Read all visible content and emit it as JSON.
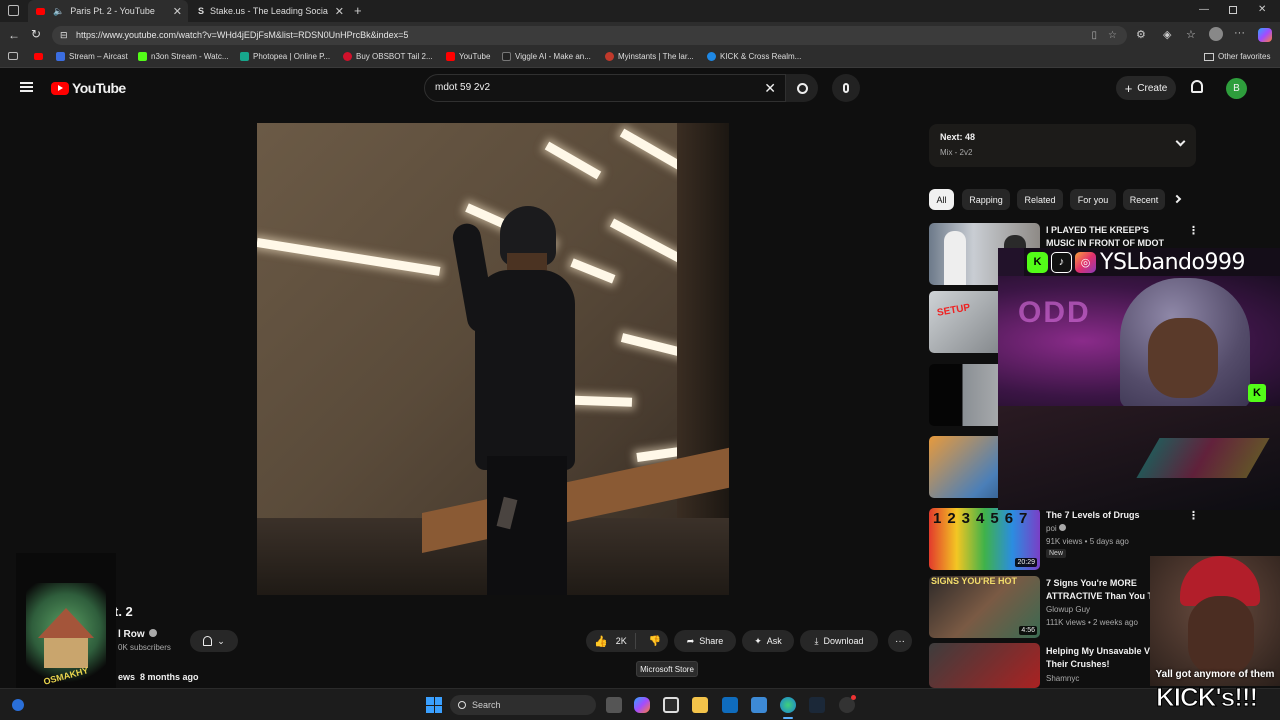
{
  "browser": {
    "tabs": [
      {
        "title": "Paris Pt. 2 - YouTube",
        "active": true
      },
      {
        "title": "Stake.us - The Leading Social Cas",
        "active": false
      }
    ],
    "url": "https://www.youtube.com/watch?v=WHd4jEDjFsM&list=RDSN0UnHPrcBk&index=5",
    "bookmarks": [
      {
        "label": "Stream – Aircast",
        "color": "#3b6de0"
      },
      {
        "label": "n3on Stream - Watc...",
        "color": "#53fc18"
      },
      {
        "label": "Photopea | Online P...",
        "color": "#17a68c"
      },
      {
        "label": "Buy OBSBOT Tail 2...",
        "color": "#d0112b"
      },
      {
        "label": "YouTube",
        "color": "#ff0000"
      },
      {
        "label": "Viggle AI - Make an...",
        "color": "#222222"
      },
      {
        "label": "Myinstants | The lar...",
        "color": "#c0392b"
      },
      {
        "label": "KICK & Cross Realm...",
        "color": "#1e88e5"
      }
    ],
    "other_favorites": "Other favorites"
  },
  "youtube": {
    "logo_text": "YouTube",
    "search_query": "mdot 59 2v2",
    "create_label": "Create",
    "avatar_initial": "B"
  },
  "video": {
    "title_visible": "t. 2",
    "channel_visible": "l Row",
    "subs_visible": "0K subscribers",
    "views_visible": "ews",
    "age": "8 months ago",
    "like_count": "2K",
    "share_label": "Share",
    "ask_label": "Ask",
    "download_label": "Download",
    "tooltip": "Microsoft Store"
  },
  "sidebar": {
    "queue_title": "Next: 48",
    "queue_subtitle": "Mix - 2v2",
    "chips": [
      "All",
      "Rapping",
      "Related",
      "For you",
      "Recent"
    ],
    "items": [
      {
        "title": "I PLAYED THE KREEP'S MUSIC IN FRONT OF MDOT 59 AND ...",
        "channel": "",
        "meta": "",
        "badge": "",
        "duration": ""
      },
      {
        "title": "The 7 Levels of Drugs",
        "channel": "poi",
        "meta": "91K views • 5 days ago",
        "badge": "New",
        "duration": "20:29"
      },
      {
        "title": "7 Signs You're MORE ATTRACTIVE Than You T",
        "channel": "Glowup Guy",
        "meta": "111K views • 2 weeks ago",
        "badge": "",
        "duration": "4:56"
      },
      {
        "title": "Helping My Unsavable Vi Rizz Their Crushes!",
        "channel": "Shamnyc",
        "meta": "",
        "badge": "",
        "duration": ""
      }
    ]
  },
  "overlay": {
    "handle": "YSLbando999",
    "meme_caption": "Yall got anymore of them",
    "meme_big": "KICK's!!!",
    "logo_text": "OSMAKHY"
  },
  "taskbar": {
    "search_placeholder": "Search"
  }
}
